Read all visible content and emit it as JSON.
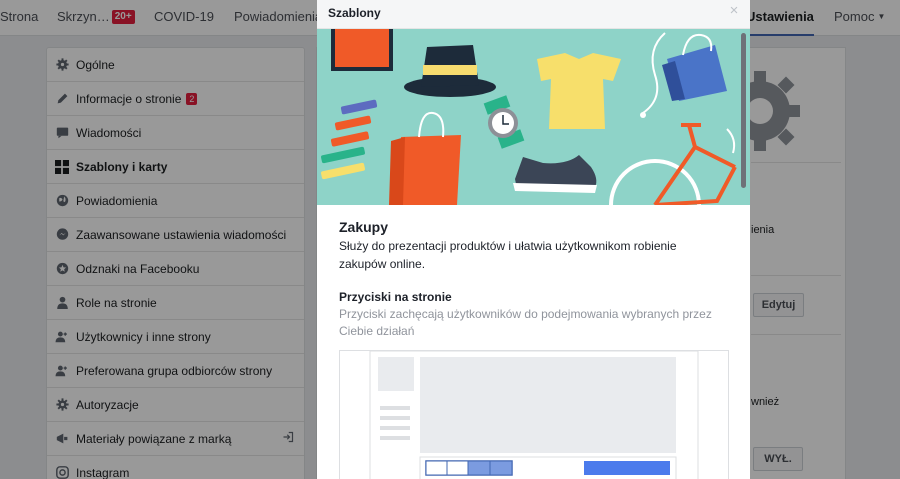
{
  "topnav": {
    "items": [
      {
        "label": "Strona"
      },
      {
        "label": "Skrzyn…",
        "badge": "20+"
      },
      {
        "label": "COVID-19"
      },
      {
        "label": "Powiadomienia"
      },
      {
        "label": "Ustawienia"
      },
      {
        "label": "Pomoc"
      }
    ]
  },
  "sidebar": {
    "items": [
      {
        "label": "Ogólne",
        "icon": "gear-icon"
      },
      {
        "label": "Informacje o stronie",
        "icon": "pencil-icon",
        "badge": "2"
      },
      {
        "label": "Wiadomości",
        "icon": "message-icon"
      },
      {
        "label": "Szablony i karty",
        "icon": "grid-icon"
      },
      {
        "label": "Powiadomienia",
        "icon": "globe-icon"
      },
      {
        "label": "Zaawansowane ustawienia wiadomości",
        "icon": "messenger-icon"
      },
      {
        "label": "Odznaki na Facebooku",
        "icon": "badge-star-icon"
      },
      {
        "label": "Role na stronie",
        "icon": "person-icon"
      },
      {
        "label": "Użytkownicy i inne strony",
        "icon": "people-icon"
      },
      {
        "label": "Preferowana grupa odbiorców strony",
        "icon": "audience-icon"
      },
      {
        "label": "Autoryzacje",
        "icon": "gear-small-icon"
      },
      {
        "label": "Materiały powiązane z marką",
        "icon": "branded-content-icon"
      },
      {
        "label": "Instagram",
        "icon": "instagram-icon"
      }
    ]
  },
  "background": {
    "text_1": "ienia",
    "edit_button": "Edytuj",
    "text_2": "wnież",
    "off_button": "WYŁ."
  },
  "modal": {
    "title": "Szablony",
    "section_title": "Zakupy",
    "section_description": "Służy do prezentacji produktów i ułatwia użytkownikom robienie zakupów online.",
    "subsection_title": "Przyciski na stronie",
    "subsection_description": "Przyciski zachęcają użytkowników do podejmowania wybranych przez Ciebie działań"
  },
  "colors": {
    "accent": "#4267b2",
    "hero_bg": "#8ed3c8",
    "badge": "#e41e3f"
  }
}
